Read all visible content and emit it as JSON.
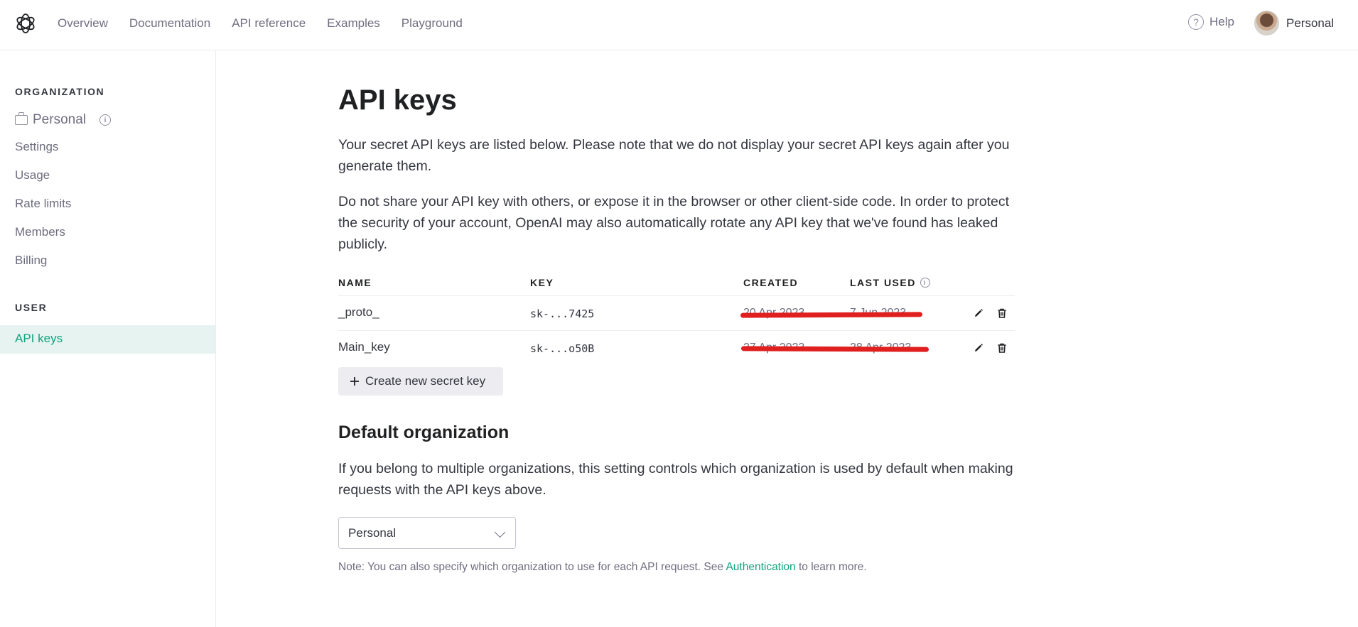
{
  "nav": {
    "links": [
      "Overview",
      "Documentation",
      "API reference",
      "Examples",
      "Playground"
    ],
    "help_label": "Help",
    "account_label": "Personal"
  },
  "sidebar": {
    "org_section": "ORGANIZATION",
    "org_name": "Personal",
    "items": [
      "Settings",
      "Usage",
      "Rate limits",
      "Members",
      "Billing"
    ],
    "user_section": "USER",
    "active_item": "API keys"
  },
  "main": {
    "title": "API keys",
    "intro": "Your secret API keys are listed below. Please note that we do not display your secret API keys again after you generate them.",
    "warning": "Do not share your API key with others, or expose it in the browser or other client-side code. In order to protect the security of your account, OpenAI may also automatically rotate any API key that we've found has leaked publicly.",
    "table": {
      "headers": [
        "NAME",
        "KEY",
        "CREATED",
        "LAST USED"
      ],
      "rows": [
        {
          "name": "_proto_",
          "key": "sk-...7425",
          "created": "20 Apr 2023",
          "last_used": "7 Jun 2023"
        },
        {
          "name": "Main_key",
          "key": "sk-...o50B",
          "created": "27 Apr 2023",
          "last_used": "28 Apr 2023"
        }
      ]
    },
    "create_button": "Create new secret key",
    "default_org_title": "Default organization",
    "default_org_desc": "If you belong to multiple organizations, this setting controls which organization is used by default when making requests with the API keys above.",
    "org_select_value": "Personal",
    "note_prefix": "Note: You can also specify which organization to use for each API request. See ",
    "note_link": "Authentication",
    "note_suffix": " to learn more."
  },
  "colors": {
    "accent": "#10a37f",
    "active_bg": "#e6f3f0",
    "redaction": "#e01f1f"
  }
}
